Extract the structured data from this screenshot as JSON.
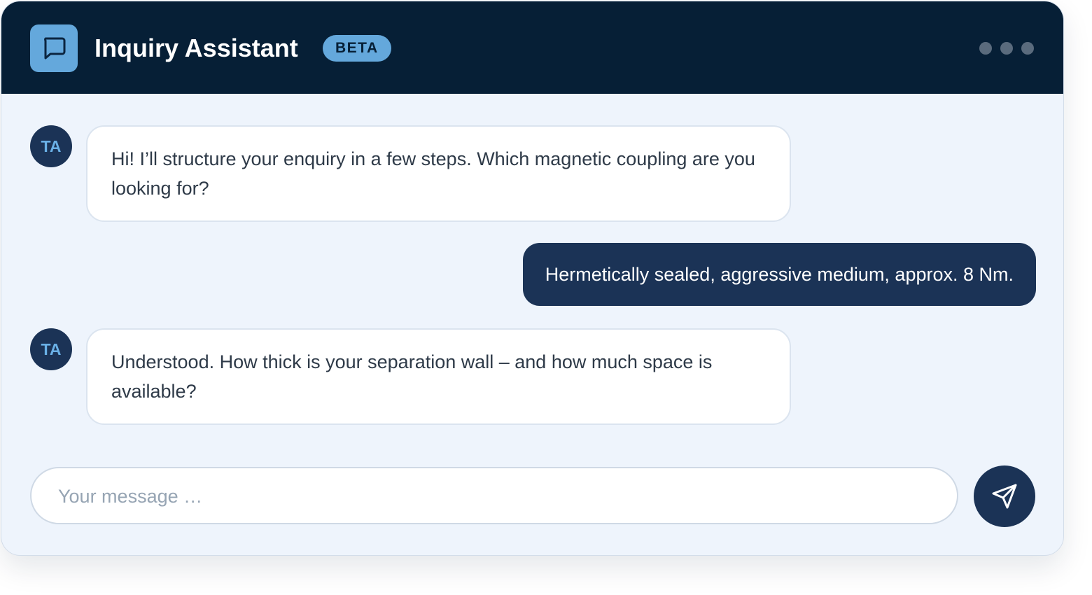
{
  "header": {
    "title": "Inquiry Assistant",
    "badge": "BETA",
    "app_icon": "chat-bubble-icon",
    "menu_icon": "more-dots-icon"
  },
  "messages": [
    {
      "sender": "assistant",
      "avatar": "TA",
      "text": "Hi! I’ll structure your enquiry in a few steps. Which magnetic coupling are you looking for?"
    },
    {
      "sender": "user",
      "text": "Hermetically sealed, aggressive medium, approx. 8 Nm."
    },
    {
      "sender": "assistant",
      "avatar": "TA",
      "text": "Understood. How thick is your separation wall – and how much space is available?"
    }
  ],
  "composer": {
    "placeholder": "Your message …",
    "value": "",
    "send_icon": "send-icon"
  },
  "colors": {
    "header_bg": "#061f36",
    "accent": "#64a8dc",
    "user_bubble": "#1b3356",
    "chat_bg": "#eef4fc"
  }
}
